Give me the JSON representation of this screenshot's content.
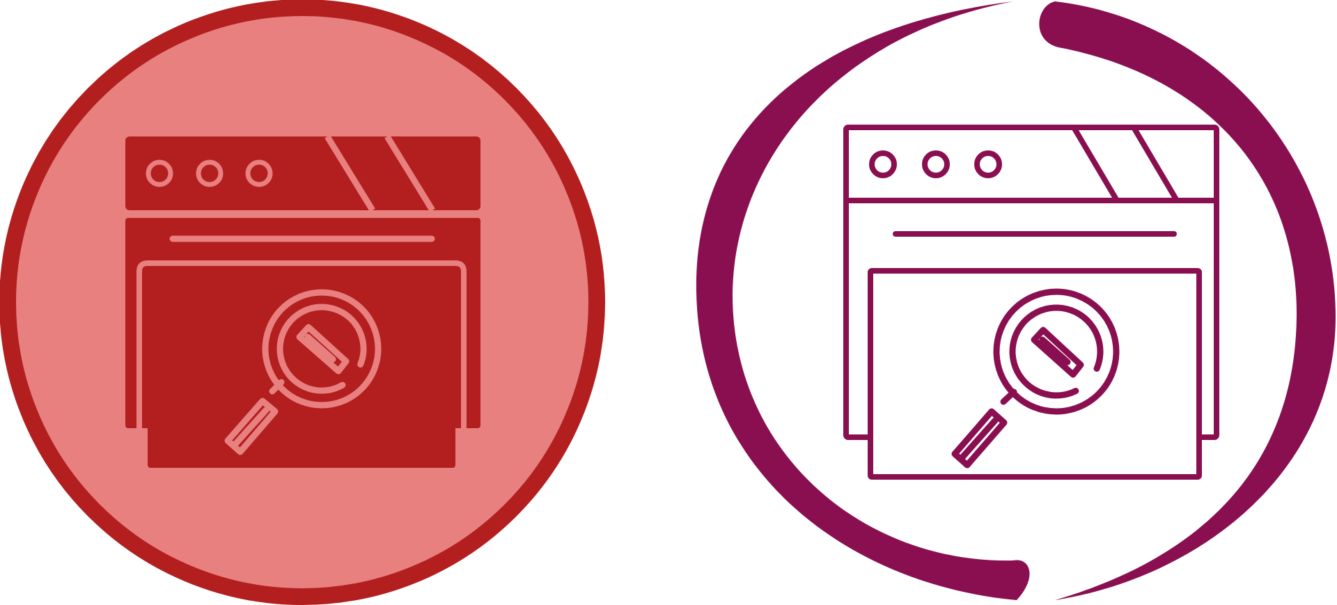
{
  "icons": [
    {
      "name": "web-search-glyph-icon",
      "style": "glyph",
      "colors": {
        "circle_fill": "#E88080",
        "circle_ring": "#B31E1E",
        "glyph": "#B31E1E",
        "glyph_detail": "#E88080"
      }
    },
    {
      "name": "web-search-outline-icon",
      "style": "outline",
      "colors": {
        "stroke": "#8A0F50",
        "ring": "#8A0F50",
        "background": "#FFFFFF"
      }
    }
  ]
}
